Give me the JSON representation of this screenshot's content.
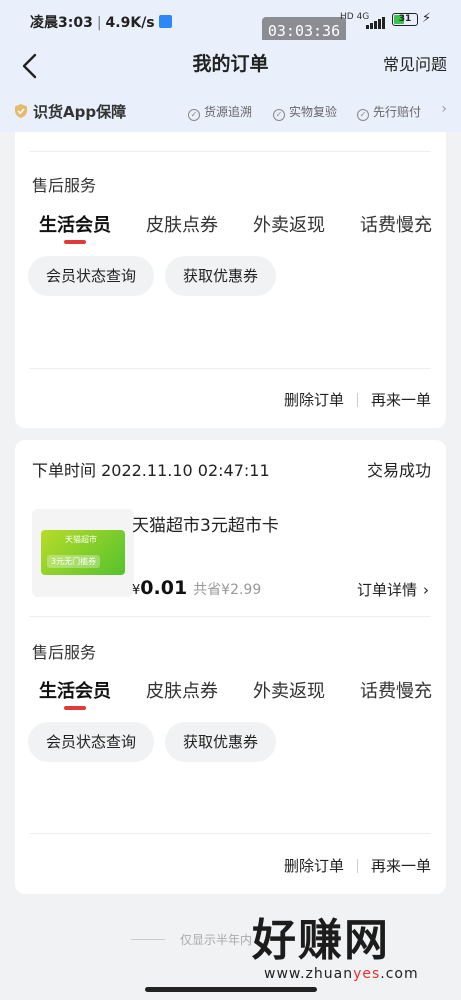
{
  "statusbar": {
    "time": "凌晨3:03",
    "speed": "4.9K/s",
    "clock": "03:03:36",
    "network": "4G",
    "hd": "HD",
    "battery": "31"
  },
  "navbar": {
    "title": "我的订单",
    "faq": "常见问题"
  },
  "guarantee": {
    "brand": "识货App保障",
    "features": [
      "货源追溯",
      "实物复验",
      "先行赔付"
    ]
  },
  "after_sales_title": "售后服务",
  "tabs": [
    "生活会员",
    "皮肤点券",
    "外卖返现",
    "话费慢充"
  ],
  "pills": [
    "会员状态查询",
    "获取优惠券"
  ],
  "actions": {
    "delete": "删除订单",
    "reorder": "再来一单"
  },
  "order": {
    "time": "下单时间 2022.11.10 02:47:11",
    "status": "交易成功",
    "product_name": "天猫超市3元超市卡",
    "card_brand": "天猫超市",
    "card_text": "3元无门槛券",
    "currency": "¥",
    "price": "0.01",
    "saving": "共省¥2.99",
    "detail": "订单详情"
  },
  "footer_note": "仅显示半年内",
  "watermark": {
    "text": "好赚网",
    "url_pre": "www.zhuan",
    "url_hl": "yes",
    "url_post": ".com"
  },
  "colors": {
    "accent": "#e23a3a",
    "header_bg": "#eaf0fb",
    "page_bg": "#f1f2f4"
  }
}
